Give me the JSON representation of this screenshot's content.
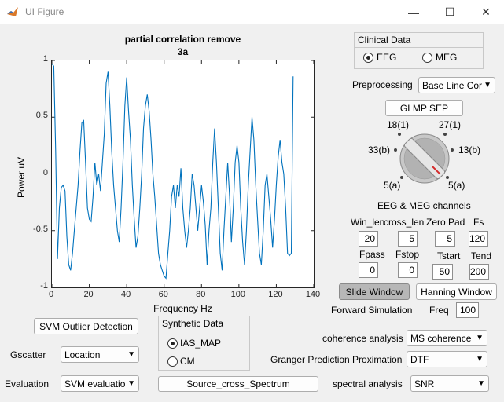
{
  "window": {
    "title": "UI Figure"
  },
  "plot": {
    "title": "partial correlation remove",
    "subtitle": "3a",
    "xlabel": "Frequency Hz",
    "ylabel": "Power uV",
    "xticks": [
      "0",
      "20",
      "40",
      "60",
      "80",
      "100",
      "120",
      "140"
    ],
    "yticks": [
      "1",
      "0.5",
      "0",
      "-0.5",
      "-1"
    ]
  },
  "chart_data": {
    "type": "line",
    "title": "partial correlation remove",
    "subtitle": "3a",
    "xlabel": "Frequency Hz",
    "ylabel": "Power uV",
    "xlim": [
      0,
      140
    ],
    "ylim": [
      -1,
      1
    ],
    "grid": false,
    "series": [
      {
        "color": "#0072bd",
        "x": [
          0,
          1,
          2,
          3,
          4,
          5,
          6,
          7,
          8,
          9,
          10,
          11,
          12,
          13,
          14,
          15,
          16,
          17,
          18,
          19,
          20,
          21,
          22,
          23,
          24,
          25,
          26,
          27,
          28,
          29,
          30,
          31,
          32,
          33,
          34,
          35,
          36,
          37,
          38,
          39,
          40,
          41,
          42,
          43,
          44,
          45,
          46,
          47,
          48,
          49,
          50,
          51,
          52,
          53,
          54,
          55,
          56,
          57,
          58,
          59,
          60,
          61,
          62,
          63,
          64,
          65,
          66,
          67,
          68,
          69,
          70,
          71,
          72,
          73,
          74,
          75,
          76,
          77,
          78,
          79,
          80,
          81,
          82,
          83,
          84,
          85,
          86,
          87,
          88,
          89,
          90,
          91,
          92,
          93,
          94,
          95,
          96,
          97,
          98,
          99,
          100,
          101,
          102,
          103,
          104,
          105,
          106,
          107,
          108,
          109,
          110,
          111,
          112,
          113,
          114,
          115,
          116,
          117,
          118,
          119,
          120,
          121,
          122,
          123,
          124,
          125,
          126,
          127,
          128,
          129
        ],
        "y": [
          0.97,
          0.95,
          0.2,
          -0.75,
          -0.3,
          -0.12,
          -0.1,
          -0.15,
          -0.55,
          -0.8,
          -0.85,
          -0.7,
          -0.5,
          -0.3,
          -0.1,
          0.2,
          0.45,
          0.47,
          0.1,
          -0.3,
          -0.4,
          -0.42,
          -0.2,
          0.1,
          -0.1,
          0.0,
          -0.15,
          0.1,
          0.35,
          0.8,
          0.9,
          0.6,
          0.2,
          -0.1,
          -0.3,
          -0.5,
          -0.6,
          -0.3,
          0.1,
          0.6,
          0.85,
          0.55,
          0.3,
          -0.1,
          -0.4,
          -0.65,
          -0.55,
          -0.3,
          0.0,
          0.4,
          0.6,
          0.7,
          0.55,
          0.3,
          0.0,
          -0.2,
          -0.45,
          -0.7,
          -0.8,
          -0.85,
          -0.9,
          -0.92,
          -0.7,
          -0.5,
          -0.2,
          -0.1,
          -0.3,
          -0.1,
          -0.2,
          0.05,
          -0.3,
          -0.5,
          -0.65,
          -0.5,
          -0.3,
          0.0,
          -0.1,
          -0.3,
          -0.5,
          -0.3,
          -0.1,
          -0.25,
          -0.45,
          -0.8,
          -0.5,
          -0.3,
          0.1,
          0.4,
          0.1,
          -0.3,
          -0.7,
          -0.85,
          -0.5,
          -0.2,
          0.1,
          -0.2,
          -0.6,
          -0.3,
          0.1,
          0.25,
          0.1,
          -0.3,
          -0.6,
          -0.8,
          -0.5,
          -0.1,
          0.2,
          0.5,
          0.3,
          -0.1,
          -0.4,
          -0.7,
          -0.8,
          -0.5,
          -0.1,
          0.0,
          -0.2,
          -0.4,
          -0.65,
          -0.4,
          -0.1,
          0.15,
          0.3,
          0.1,
          0.0,
          -0.3,
          -0.7,
          -0.72,
          -0.7,
          0.86
        ]
      }
    ]
  },
  "clinical": {
    "title": "Clinical Data",
    "options": [
      "EEG",
      "MEG"
    ],
    "selected": "EEG"
  },
  "preprocessing": {
    "label": "Preprocessing",
    "value": "Base Line Corr"
  },
  "glmp_button": "GLMP SEP",
  "knob": {
    "labels": [
      "18(1)",
      "27(1)",
      "33(b)",
      "13(b)",
      "5(a)",
      "5(a)"
    ]
  },
  "channels_label": "EEG & MEG channels",
  "params": {
    "win_len": {
      "label": "Win_len",
      "value": "20"
    },
    "cross_len": {
      "label": "cross_len",
      "value": "5"
    },
    "zero_pad": {
      "label": "Zero Pad",
      "value": "5"
    },
    "fs": {
      "label": "Fs",
      "value": "120"
    },
    "fpass": {
      "label": "Fpass",
      "value": "0"
    },
    "fstop": {
      "label": "Fstop",
      "value": "0"
    },
    "tstart": {
      "label": "Tstart",
      "value": "50"
    },
    "tend": {
      "label": "Tend",
      "value": "200"
    }
  },
  "buttons": {
    "slide_window": "Slide Window",
    "hanning_window": "Hanning Window",
    "svm_outlier": "SVM Outlier Detection",
    "source_cross": "Source_cross_Spectrum"
  },
  "forward_sim": {
    "label": "Forward Simulation",
    "freq_label": "Freq",
    "freq_value": "100"
  },
  "synthetic": {
    "title": "Synthetic Data",
    "options": [
      "IAS_MAP",
      "CM"
    ],
    "selected": "IAS_MAP"
  },
  "gscatter": {
    "label": "Gscatter",
    "value": "Location"
  },
  "evaluation": {
    "label": "Evaluation",
    "value": "SVM evaluation"
  },
  "coherence": {
    "label": "coherence analysis",
    "value": "MS coherence"
  },
  "granger": {
    "label": "Granger Prediction Proximation",
    "value": "DTF"
  },
  "spectral": {
    "label": "spectral analysis",
    "value": "SNR"
  }
}
